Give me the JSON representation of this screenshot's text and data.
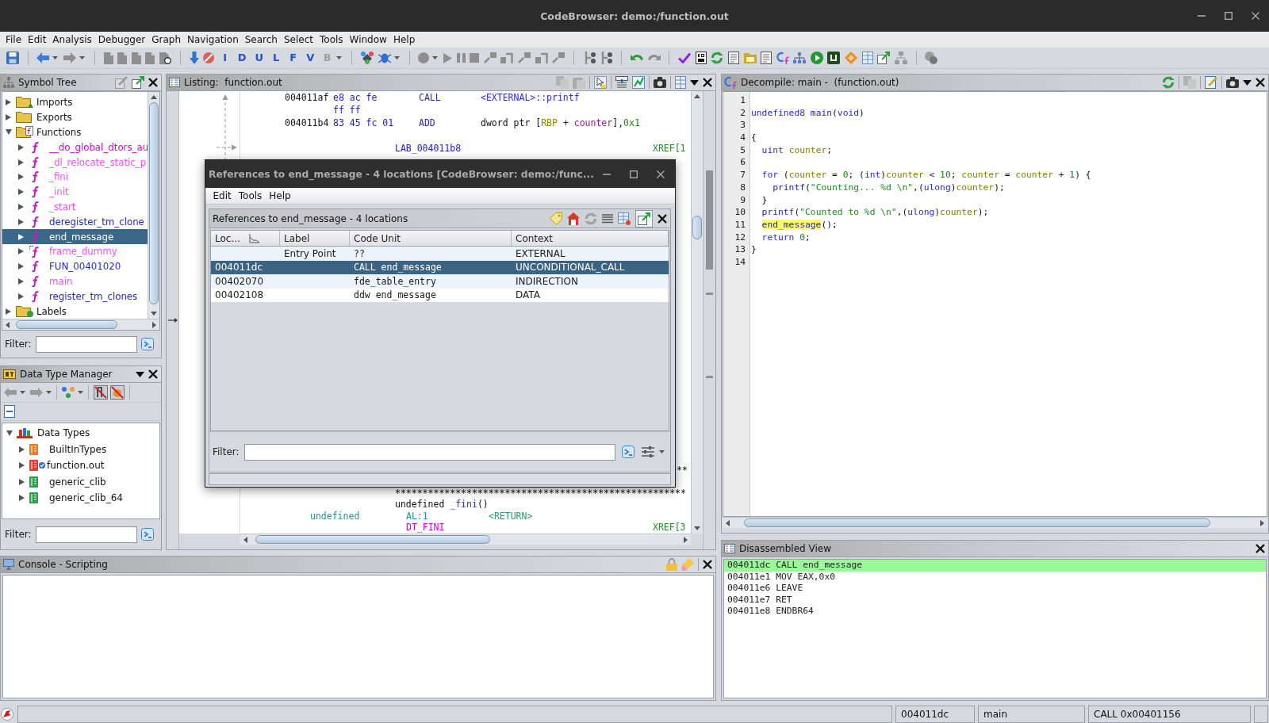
{
  "window": {
    "title": "CodeBrowser: demo:/function.out"
  },
  "menu": [
    "File",
    "Edit",
    "Analysis",
    "Debugger",
    "Graph",
    "Navigation",
    "Search",
    "Select",
    "Tools",
    "Window",
    "Help"
  ],
  "toolbar": {
    "letter_buttons": [
      {
        "text": "I",
        "disabled": false
      },
      {
        "text": "D",
        "disabled": false
      },
      {
        "text": "U",
        "disabled": false
      },
      {
        "text": "L",
        "disabled": false
      },
      {
        "text": "F",
        "disabled": false
      },
      {
        "text": "V",
        "disabled": false
      },
      {
        "text": "B",
        "disabled": true
      }
    ]
  },
  "symbol_tree": {
    "title": "Symbol Tree",
    "items": [
      {
        "label": "Imports",
        "kind": "imports",
        "expanded": false,
        "selected": false
      },
      {
        "label": "Exports",
        "kind": "exports",
        "expanded": false,
        "selected": false
      },
      {
        "label": "Functions",
        "kind": "functions",
        "expanded": true,
        "selected": false,
        "children": [
          {
            "label": "__do_global_dtors_au",
            "kind": "function",
            "color": "#dd00dd",
            "expanded": false,
            "selected": false
          },
          {
            "label": "_dl_relocate_static_p",
            "kind": "function",
            "color": "#ff4dff",
            "expanded": false,
            "selected": false
          },
          {
            "label": "_fini",
            "kind": "function",
            "color": "#ff4dff",
            "expanded": false,
            "selected": false
          },
          {
            "label": "_init",
            "kind": "function",
            "color": "#ff4dff",
            "expanded": false,
            "selected": false
          },
          {
            "label": "_start",
            "kind": "function",
            "color": "#ff4dff",
            "expanded": false,
            "selected": false
          },
          {
            "label": "deregister_tm_clone",
            "kind": "function",
            "color": "#1f1fe6",
            "expanded": false,
            "selected": false
          },
          {
            "label": "end_message",
            "kind": "function",
            "expanded": false,
            "selected": true
          },
          {
            "label": "frame_dummy",
            "kind": "arrowed",
            "color": "#ff4dff",
            "expanded": false,
            "selected": false
          },
          {
            "label": "FUN_00401020",
            "kind": "function",
            "color": "#1f1fe6",
            "expanded": false,
            "selected": false
          },
          {
            "label": "main",
            "kind": "function",
            "color": "#ff4dff",
            "expanded": false,
            "selected": false
          },
          {
            "label": "register_tm_clones",
            "kind": "function",
            "color": "#1f1fe6",
            "expanded": false,
            "selected": false
          }
        ]
      },
      {
        "label": "Labels",
        "kind": "labels",
        "expanded": false,
        "selected": false
      }
    ],
    "filter": {
      "label": "Filter:"
    }
  },
  "data_type_manager": {
    "title": "Data Type Manager",
    "items": [
      {
        "label": "Data Types",
        "kind": "root",
        "expanded": true,
        "selected": false,
        "children": [
          {
            "label": "BuiltInTypes",
            "kind": "builtin",
            "expanded": false,
            "selected": false
          },
          {
            "label": "function.out",
            "kind": "program",
            "expanded": false,
            "selected": false
          },
          {
            "label": "generic_clib",
            "kind": "archive",
            "expanded": false,
            "selected": false
          },
          {
            "label": "generic_clib_64",
            "kind": "archive",
            "expanded": false,
            "selected": false
          }
        ]
      }
    ],
    "filter": {
      "label": "Filter:"
    }
  },
  "listing": {
    "title": "Listing:  function.out",
    "top_lines": [
      {
        "kind": "code",
        "segments": [
          {
            "kind": "address",
            "text": "004011af"
          },
          {
            "kind": "bytes",
            "text": "e8 ac fe"
          },
          {
            "kind": "mnemonic",
            "text": "CALL"
          },
          {
            "kind": "operand",
            "parts": [
              {
                "text": "<EXTERNAL>::printf",
                "kind": "reference"
              }
            ]
          }
        ]
      },
      {
        "kind": "code",
        "segments": [
          {
            "kind": "bytes",
            "text": "ff ff"
          }
        ]
      },
      {
        "kind": "code",
        "segments": [
          {
            "kind": "address",
            "text": "004011b4"
          },
          {
            "kind": "bytes",
            "text": "83 45 fc 01"
          },
          {
            "kind": "mnemonic",
            "text": "ADD"
          },
          {
            "kind": "operand",
            "parts": [
              {
                "text": "dword ptr [",
                "kind": "plain"
              },
              {
                "text": "RBP",
                "kind": "register"
              },
              {
                "text": " + ",
                "kind": "plain"
              },
              {
                "text": "counter",
                "kind": "variable"
              },
              {
                "text": "],",
                "kind": "plain"
              },
              {
                "text": "0x1",
                "kind": "constant"
              }
            ]
          }
        ]
      },
      {
        "kind": "blank"
      },
      {
        "kind": "code",
        "segments": [
          {
            "kind": "label",
            "text": "LAB_004011b8"
          },
          {
            "kind": "xref",
            "text": "XREF[1"
          }
        ]
      }
    ],
    "bottom_lines": [
      {
        "kind": "code",
        "segments": [
          {
            "kind": "tail",
            "text": "**"
          }
        ]
      },
      {
        "kind": "blank"
      },
      {
        "kind": "code",
        "segments": [
          {
            "kind": "separator",
            "text": "*****************************************************"
          }
        ]
      },
      {
        "kind": "code",
        "segments": [
          {
            "kind": "signature",
            "parts": [
              {
                "text": "undefined ",
                "kind": "plain"
              },
              {
                "text": "_fini",
                "kind": "reference"
              },
              {
                "text": "()",
                "kind": "plain"
              }
            ]
          }
        ]
      },
      {
        "kind": "code",
        "segments": [
          {
            "kind": "type",
            "text": "undefined"
          },
          {
            "kind": "storage",
            "text": "AL:1"
          },
          {
            "kind": "retname",
            "text": "<RETURN>"
          }
        ]
      },
      {
        "kind": "code",
        "segments": [
          {
            "kind": "symbol",
            "text": "DT_FINI"
          },
          {
            "kind": "xref",
            "text": "XREF[3"
          }
        ]
      }
    ]
  },
  "references_dialog": {
    "title": "References to end_message - 4 locations [CodeBrowser: demo:/func...",
    "menu": [
      "Edit",
      "Tools",
      "Help"
    ],
    "panel_title": "References to end_message - 4 locations",
    "columns": [
      "Loc...",
      "Label",
      "Code Unit",
      "Context"
    ],
    "rows": [
      {
        "label": "Entry Point",
        "code_unit": "??",
        "context": "EXTERNAL",
        "selected": false
      },
      {
        "location": "004011dc",
        "code_unit": "CALL end_message",
        "context": "UNCONDITIONAL_CALL",
        "selected": true
      },
      {
        "location": "00402070",
        "code_unit": "fde_table_entry",
        "context": "INDIRECTION",
        "selected": false
      },
      {
        "location": "00402108",
        "code_unit": "ddw end_message",
        "context": "DATA",
        "selected": false
      }
    ],
    "filter": {
      "label": "Filter:"
    }
  },
  "decompile": {
    "title": "Decompile: main -  (function.out)",
    "lines": [
      {
        "number": "1"
      },
      {
        "number": "2",
        "tokens": [
          {
            "text": "undefined8 ",
            "kind": "type"
          },
          {
            "text": "main",
            "kind": "function"
          },
          {
            "text": "(",
            "kind": "plain"
          },
          {
            "text": "void",
            "kind": "type"
          },
          {
            "text": ")",
            "kind": "plain"
          }
        ]
      },
      {
        "number": "3"
      },
      {
        "number": "4",
        "tokens": [
          {
            "text": "{",
            "kind": "plain"
          }
        ]
      },
      {
        "number": "5",
        "tokens": [
          {
            "text": "  uint ",
            "kind": "type"
          },
          {
            "text": "counter",
            "kind": "variable"
          },
          {
            "text": ";",
            "kind": "plain"
          }
        ]
      },
      {
        "number": "6"
      },
      {
        "number": "7",
        "tokens": [
          {
            "text": "  for ",
            "kind": "keyword"
          },
          {
            "text": "(",
            "kind": "plain"
          },
          {
            "text": "counter",
            "kind": "variable"
          },
          {
            "text": " = ",
            "kind": "plain"
          },
          {
            "text": "0",
            "kind": "constant"
          },
          {
            "text": "; (",
            "kind": "plain"
          },
          {
            "text": "int",
            "kind": "type"
          },
          {
            "text": ")",
            "kind": "plain"
          },
          {
            "text": "counter",
            "kind": "variable"
          },
          {
            "text": " < ",
            "kind": "plain"
          },
          {
            "text": "10",
            "kind": "constant"
          },
          {
            "text": "; ",
            "kind": "plain"
          },
          {
            "text": "counter",
            "kind": "variable"
          },
          {
            "text": " = ",
            "kind": "plain"
          },
          {
            "text": "counter",
            "kind": "variable"
          },
          {
            "text": " + ",
            "kind": "plain"
          },
          {
            "text": "1",
            "kind": "constant"
          },
          {
            "text": ") {",
            "kind": "plain"
          }
        ]
      },
      {
        "number": "8",
        "tokens": [
          {
            "text": "    printf",
            "kind": "function"
          },
          {
            "text": "(",
            "kind": "plain"
          },
          {
            "text": "\"Counting... %d \\n\"",
            "kind": "string"
          },
          {
            "text": ",(",
            "kind": "plain"
          },
          {
            "text": "ulong",
            "kind": "type"
          },
          {
            "text": ")",
            "kind": "plain"
          },
          {
            "text": "counter",
            "kind": "variable"
          },
          {
            "text": ");",
            "kind": "plain"
          }
        ]
      },
      {
        "number": "9",
        "tokens": [
          {
            "text": "  }",
            "kind": "plain"
          }
        ]
      },
      {
        "number": "10",
        "tokens": [
          {
            "text": "  printf",
            "kind": "function"
          },
          {
            "text": "(",
            "kind": "plain"
          },
          {
            "text": "\"Counted to %d \\n\"",
            "kind": "string"
          },
          {
            "text": ",(",
            "kind": "plain"
          },
          {
            "text": "ulong",
            "kind": "type"
          },
          {
            "text": ")",
            "kind": "plain"
          },
          {
            "text": "counter",
            "kind": "variable"
          },
          {
            "text": ");",
            "kind": "plain"
          }
        ]
      },
      {
        "number": "11",
        "tokens": [
          {
            "text": "  end_message",
            "kind": "highlight"
          },
          {
            "text": "();",
            "kind": "plain"
          }
        ]
      },
      {
        "number": "12",
        "tokens": [
          {
            "text": "  return ",
            "kind": "keyword"
          },
          {
            "text": "0",
            "kind": "constant"
          },
          {
            "text": ";",
            "kind": "plain"
          }
        ]
      },
      {
        "number": "13",
        "tokens": [
          {
            "text": "}",
            "kind": "plain"
          }
        ]
      },
      {
        "number": "14"
      }
    ]
  },
  "console": {
    "title": "Console - Scripting"
  },
  "disassembled_view": {
    "title": "Disassembled View",
    "lines": [
      {
        "text": "004011dc CALL end_message",
        "selected": true
      },
      {
        "text": "004011e1 MOV EAX,0x0",
        "selected": false
      },
      {
        "text": "004011e6 LEAVE",
        "selected": false
      },
      {
        "text": "004011e7 RET",
        "selected": false
      },
      {
        "text": "004011e8 ENDBR64",
        "selected": false
      }
    ]
  },
  "status_bar": {
    "fields": [
      "004011dc",
      "main",
      "CALL 0x00401156"
    ]
  }
}
